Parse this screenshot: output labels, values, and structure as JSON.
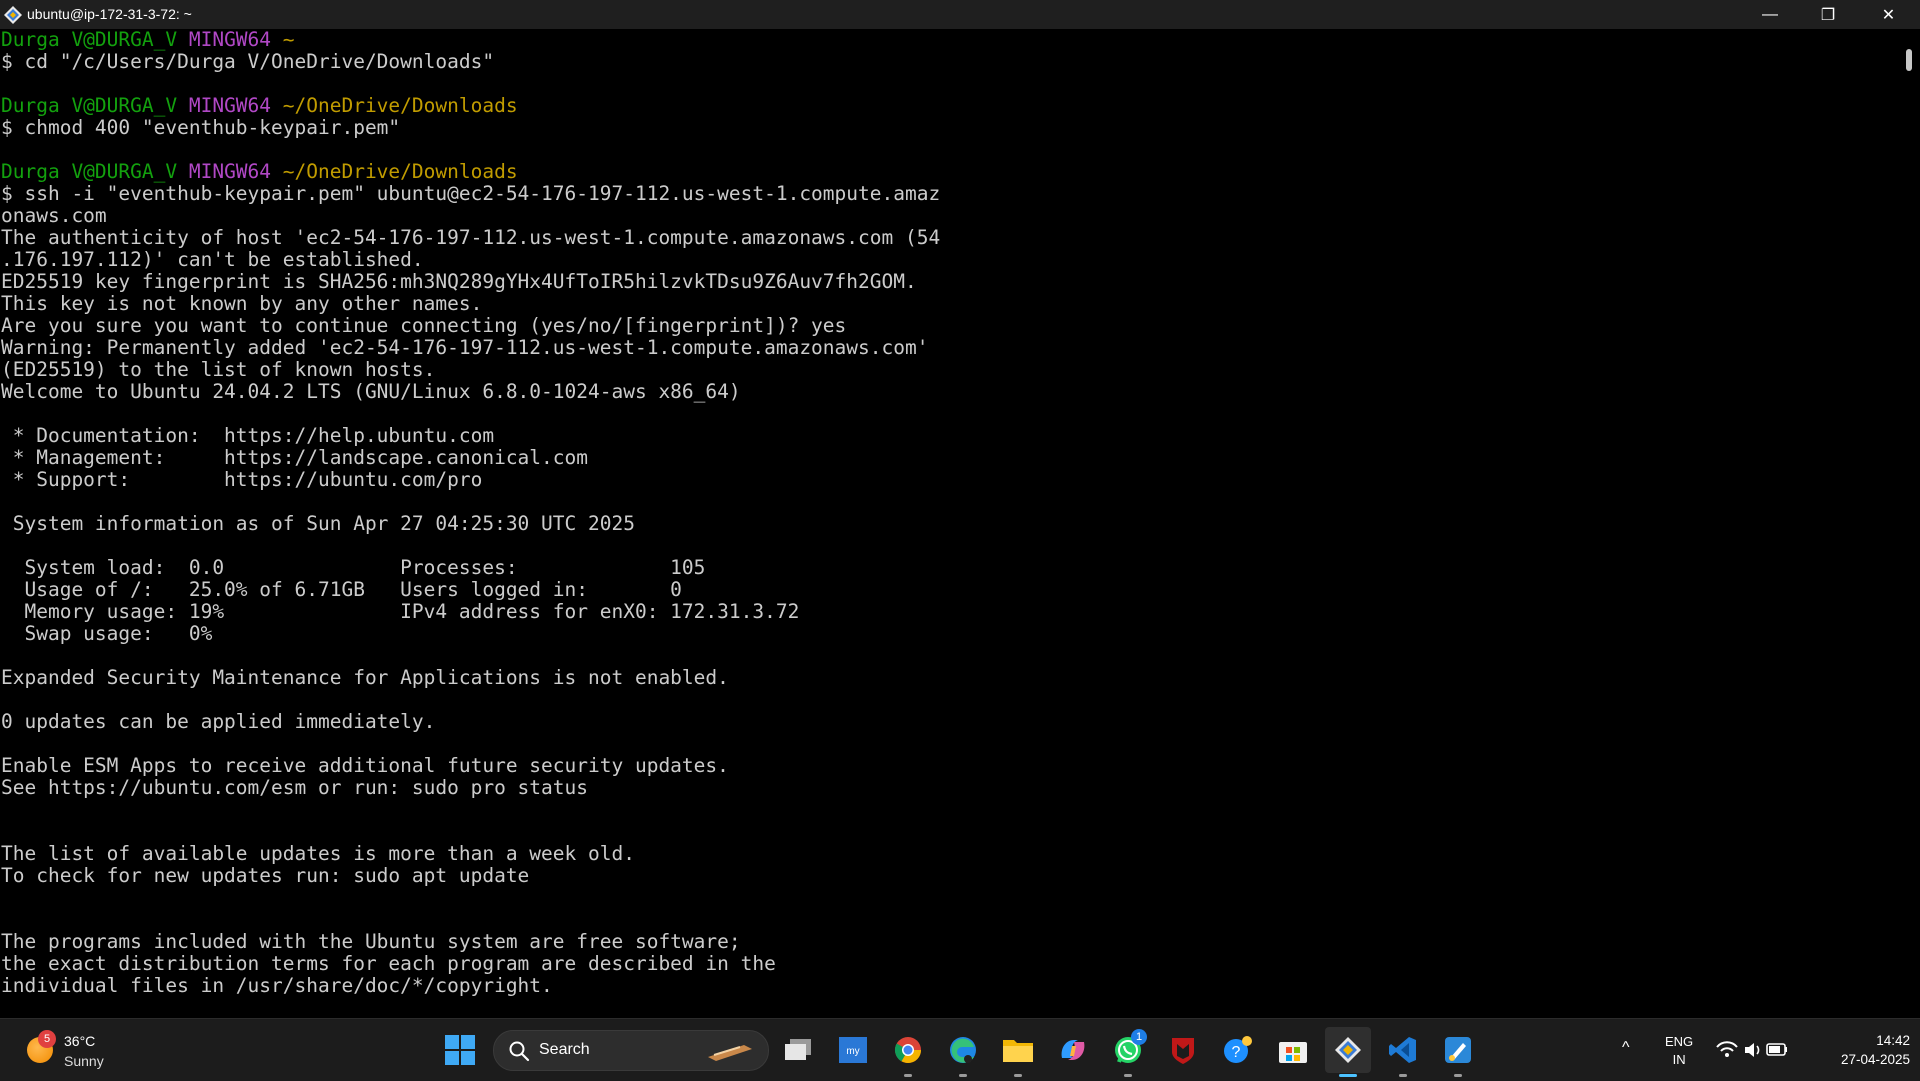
{
  "window": {
    "title": "ubuntu@ip-172-31-3-72: ~",
    "minimize_glyph": "—",
    "maximize_glyph": "❐",
    "close_glyph": "✕"
  },
  "terminal": {
    "lines": [
      [
        {
          "t": "Durga V@DURGA_V ",
          "c": "green"
        },
        {
          "t": "MINGW64 ",
          "c": "magenta"
        },
        {
          "t": "~",
          "c": "yellow"
        }
      ],
      [
        {
          "t": "$ cd \"/c/Users/Durga V/OneDrive/Downloads\"",
          "c": "white"
        }
      ],
      [
        {
          "t": "",
          "c": "white"
        }
      ],
      [
        {
          "t": "Durga V@DURGA_V ",
          "c": "green"
        },
        {
          "t": "MINGW64 ",
          "c": "magenta"
        },
        {
          "t": "~/OneDrive/Downloads",
          "c": "yellow"
        }
      ],
      [
        {
          "t": "$ chmod 400 \"eventhub-keypair.pem\"",
          "c": "white"
        }
      ],
      [
        {
          "t": "",
          "c": "white"
        }
      ],
      [
        {
          "t": "Durga V@DURGA_V ",
          "c": "green"
        },
        {
          "t": "MINGW64 ",
          "c": "magenta"
        },
        {
          "t": "~/OneDrive/Downloads",
          "c": "yellow"
        }
      ],
      [
        {
          "t": "$ ssh -i \"eventhub-keypair.pem\" ubuntu@ec2-54-176-197-112.us-west-1.compute.amaz",
          "c": "white"
        }
      ],
      [
        {
          "t": "onaws.com",
          "c": "white"
        }
      ],
      [
        {
          "t": "The authenticity of host 'ec2-54-176-197-112.us-west-1.compute.amazonaws.com (54",
          "c": "white"
        }
      ],
      [
        {
          "t": ".176.197.112)' can't be established.",
          "c": "white"
        }
      ],
      [
        {
          "t": "ED25519 key fingerprint is SHA256:mh3NQ289gYHx4UfToIR5hilzvkTDsu9Z6Auv7fh2GOM.",
          "c": "white"
        }
      ],
      [
        {
          "t": "This key is not known by any other names.",
          "c": "white"
        }
      ],
      [
        {
          "t": "Are you sure you want to continue connecting (yes/no/[fingerprint])? yes",
          "c": "white"
        }
      ],
      [
        {
          "t": "Warning: Permanently added 'ec2-54-176-197-112.us-west-1.compute.amazonaws.com'",
          "c": "white"
        }
      ],
      [
        {
          "t": "(ED25519) to the list of known hosts.",
          "c": "white"
        }
      ],
      [
        {
          "t": "Welcome to Ubuntu 24.04.2 LTS (GNU/Linux 6.8.0-1024-aws x86_64)",
          "c": "white"
        }
      ],
      [
        {
          "t": "",
          "c": "white"
        }
      ],
      [
        {
          "t": " * Documentation:  https://help.ubuntu.com",
          "c": "white"
        }
      ],
      [
        {
          "t": " * Management:     https://landscape.canonical.com",
          "c": "white"
        }
      ],
      [
        {
          "t": " * Support:        https://ubuntu.com/pro",
          "c": "white"
        }
      ],
      [
        {
          "t": "",
          "c": "white"
        }
      ],
      [
        {
          "t": " System information as of Sun Apr 27 04:25:30 UTC 2025",
          "c": "white"
        }
      ],
      [
        {
          "t": "",
          "c": "white"
        }
      ],
      [
        {
          "t": "  System load:  0.0               Processes:             105",
          "c": "white"
        }
      ],
      [
        {
          "t": "  Usage of /:   25.0% of 6.71GB   Users logged in:       0",
          "c": "white"
        }
      ],
      [
        {
          "t": "  Memory usage: 19%               IPv4 address for enX0: 172.31.3.72",
          "c": "white"
        }
      ],
      [
        {
          "t": "  Swap usage:   0%",
          "c": "white"
        }
      ],
      [
        {
          "t": "",
          "c": "white"
        }
      ],
      [
        {
          "t": "Expanded Security Maintenance for Applications is not enabled.",
          "c": "white"
        }
      ],
      [
        {
          "t": "",
          "c": "white"
        }
      ],
      [
        {
          "t": "0 updates can be applied immediately.",
          "c": "white"
        }
      ],
      [
        {
          "t": "",
          "c": "white"
        }
      ],
      [
        {
          "t": "Enable ESM Apps to receive additional future security updates.",
          "c": "white"
        }
      ],
      [
        {
          "t": "See https://ubuntu.com/esm or run: sudo pro status",
          "c": "white"
        }
      ],
      [
        {
          "t": "",
          "c": "white"
        }
      ],
      [
        {
          "t": "",
          "c": "white"
        }
      ],
      [
        {
          "t": "The list of available updates is more than a week old.",
          "c": "white"
        }
      ],
      [
        {
          "t": "To check for new updates run: sudo apt update",
          "c": "white"
        }
      ],
      [
        {
          "t": "",
          "c": "white"
        }
      ],
      [
        {
          "t": "",
          "c": "white"
        }
      ],
      [
        {
          "t": "The programs included with the Ubuntu system are free software;",
          "c": "white"
        }
      ],
      [
        {
          "t": "the exact distribution terms for each program are described in the",
          "c": "white"
        }
      ],
      [
        {
          "t": "individual files in /usr/share/doc/*/copyright.",
          "c": "white"
        }
      ]
    ]
  },
  "taskbar": {
    "weather": {
      "temp": "36°C",
      "condition": "Sunny",
      "badge": "5"
    },
    "search": {
      "label": "Search"
    },
    "apps": [
      {
        "name": "task-view-icon",
        "left": 0
      },
      {
        "name": "mylic-app-icon"
      },
      {
        "name": "chrome-icon"
      },
      {
        "name": "edge-icon"
      },
      {
        "name": "file-explorer-icon"
      },
      {
        "name": "copilot-icon"
      },
      {
        "name": "whatsapp-icon",
        "badge": "1"
      },
      {
        "name": "mcafee-icon"
      },
      {
        "name": "get-help-icon"
      },
      {
        "name": "microsoft-store-icon"
      },
      {
        "name": "git-bash-icon",
        "active": true
      },
      {
        "name": "vscode-icon"
      },
      {
        "name": "paint-icon"
      }
    ],
    "tray": {
      "chevron": "^",
      "lang_top": "ENG",
      "lang_bottom": "IN",
      "time": "14:42",
      "date": "27-04-2025"
    }
  },
  "colors": {
    "prompt_user": "#13a10e",
    "prompt_env": "#b148c6",
    "prompt_path": "#c19c00",
    "text": "#cccccc",
    "accent": "#4cc2ff"
  }
}
